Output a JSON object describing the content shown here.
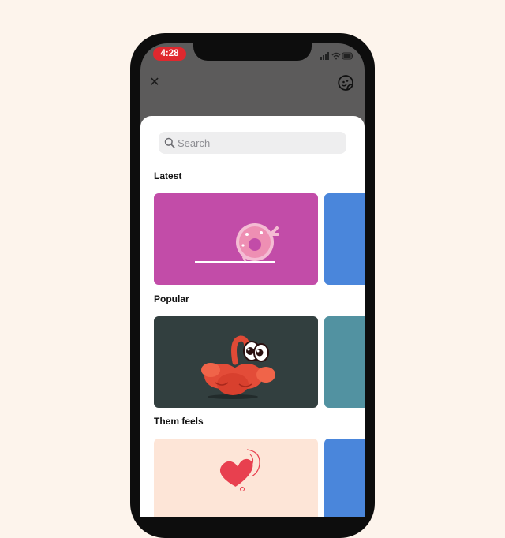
{
  "status_bar": {
    "time": "4:28"
  },
  "header": {
    "close_glyph": "✕",
    "close_icon": "close-icon",
    "sticker_icon": "sticker-icon"
  },
  "search": {
    "placeholder": "Search",
    "value": ""
  },
  "sections": [
    {
      "title": "Latest",
      "card_color": "#c24ca8",
      "peek_color": "#4a86db",
      "art": "pink-donut-sticker"
    },
    {
      "title": "Popular",
      "card_color": "#323f3f",
      "peek_color": "#5292a1",
      "art": "red-crab-sticker"
    },
    {
      "title": "Them feels",
      "card_color": "#fde5d7",
      "peek_color": "#4a86db",
      "art": "heart-sticker"
    }
  ],
  "colors": {
    "background": "#fdf4ec",
    "status_pill": "#e0282e",
    "overlay": "#5c5b5b"
  }
}
